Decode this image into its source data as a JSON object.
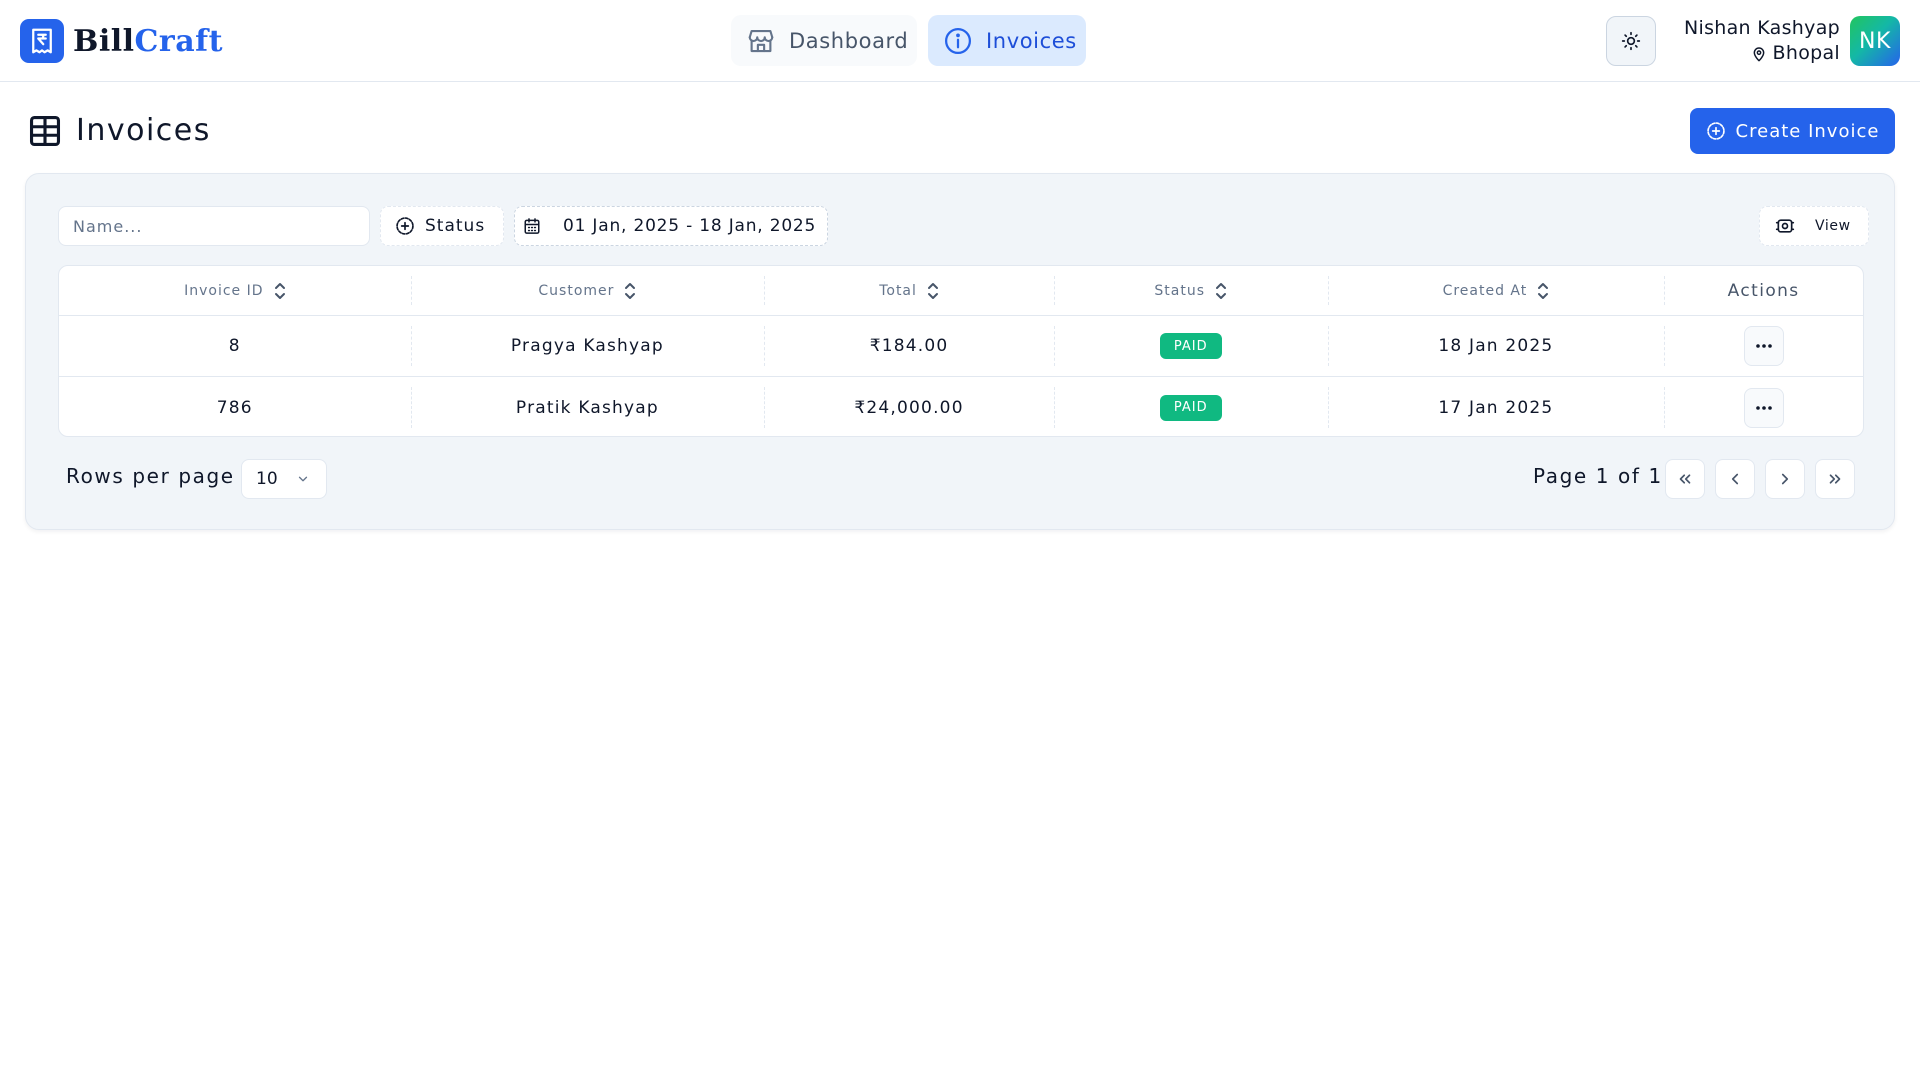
{
  "app": {
    "brand_a": "Bill",
    "brand_b": "Craft"
  },
  "nav": {
    "dashboard_label": "Dashboard",
    "invoices_label": "Invoices"
  },
  "user": {
    "name": "Nishan Kashyap",
    "location": "Bhopal",
    "initials": "NK"
  },
  "page": {
    "title": "Invoices",
    "create_label": "Create Invoice"
  },
  "filters": {
    "search_placeholder": "Name...",
    "status_label": "Status",
    "date_range": "01 Jan, 2025 - 18 Jan, 2025",
    "view_label": "View"
  },
  "table": {
    "columns": [
      "Invoice ID",
      "Customer",
      "Total",
      "Status",
      "Created At",
      "Actions"
    ],
    "rows": [
      {
        "id": "8",
        "customer": "Pragya Kashyap",
        "total": "₹184.00",
        "status": "PAID",
        "created": "18 Jan 2025"
      },
      {
        "id": "786",
        "customer": "Pratik Kashyap",
        "total": "₹24,000.00",
        "status": "PAID",
        "created": "17 Jan 2025"
      }
    ]
  },
  "pagination": {
    "rows_label": "Rows per page",
    "rows_value": "10",
    "page_info": "Page 1 of 1"
  },
  "colors": {
    "accent": "#2563eb",
    "paid": "#10b981",
    "card_bg": "#f1f5f9"
  },
  "icons": {
    "logo": "rupee-receipt-icon",
    "dashboard": "store-icon",
    "invoices": "info-icon",
    "theme": "sun-icon",
    "location": "map-pin-icon",
    "title": "table-grid-icon",
    "create": "plus-circle-icon",
    "status": "plus-circle-icon",
    "date": "calendar-icon",
    "view": "settings-view-icon",
    "sort": "sort-icon",
    "more": "ellipsis-icon",
    "rows": "chevron-down-icon",
    "first": "chevrons-left-icon",
    "prev": "chevron-left-icon",
    "next": "chevron-right-icon",
    "last": "chevrons-right-icon"
  }
}
